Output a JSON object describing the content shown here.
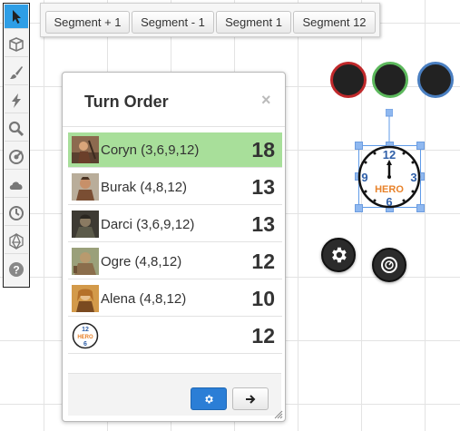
{
  "segment_bar": {
    "buttons": [
      "Segment + 1",
      "Segment - 1",
      "Segment 1",
      "Segment 12"
    ]
  },
  "toolbar": {
    "tools": [
      "select-icon",
      "cube-icon",
      "brush-icon",
      "lightning-icon",
      "magnify-icon",
      "target-icon",
      "cloud-icon",
      "clock-icon",
      "d20-icon",
      "help-icon"
    ],
    "active_tool": "select-icon",
    "accent": "#2e9ee6"
  },
  "turn_order": {
    "title": "Turn Order",
    "close_glyph": "×",
    "active_row_color": "#a8df9a",
    "rows": [
      {
        "name": "Coryn (3,6,9,12)",
        "initiative": "18",
        "avatar": "portrait-coryn",
        "active": true
      },
      {
        "name": "Burak (4,8,12)",
        "initiative": "13",
        "avatar": "portrait-burak",
        "active": false
      },
      {
        "name": "Darci (3,6,9,12)",
        "initiative": "13",
        "avatar": "portrait-darci",
        "active": false
      },
      {
        "name": "Ogre (4,8,12)",
        "initiative": "12",
        "avatar": "portrait-ogre",
        "active": false
      },
      {
        "name": "Alena (4,8,12)",
        "initiative": "10",
        "avatar": "portrait-alena",
        "active": false
      },
      {
        "name": "",
        "initiative": "12",
        "avatar": "hero-clock-icon",
        "active": false
      }
    ],
    "footer": {
      "settings_icon": "gear-icon",
      "next_icon": "arrow-right-icon"
    }
  },
  "token": {
    "clock_text": "HERO",
    "numbers": [
      "12",
      "3",
      "6",
      "9"
    ],
    "status_rings": [
      {
        "name": "red-ring",
        "color": "#c0292b"
      },
      {
        "name": "green-ring",
        "color": "#5cb85c"
      },
      {
        "name": "blue-ring",
        "color": "#4a7fc1"
      }
    ],
    "radial_buttons": [
      "gear-icon",
      "settings-dial-icon"
    ]
  }
}
